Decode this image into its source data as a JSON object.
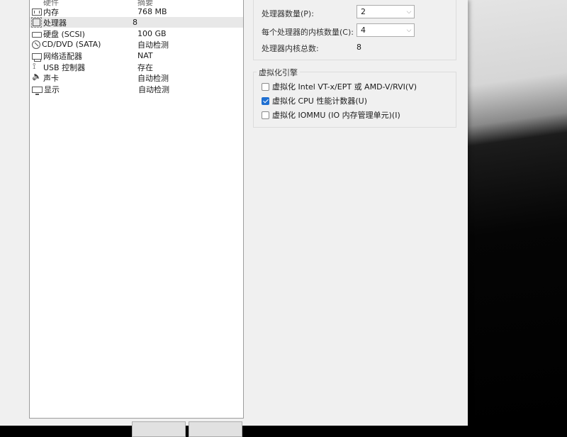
{
  "devices": [
    {
      "name": "硬件",
      "summary": "摘要",
      "icon": "none",
      "dim": true
    },
    {
      "name": "内存",
      "summary": "768 MB",
      "icon": "memory-icon"
    },
    {
      "name": "处理器",
      "summary": "8",
      "icon": "processor-icon",
      "selected": true
    },
    {
      "name": "硬盘 (SCSI)",
      "summary": "100 GB",
      "icon": "hard-disk-icon"
    },
    {
      "name": "CD/DVD (SATA)",
      "summary": "自动检测",
      "icon": "cd-dvd-icon"
    },
    {
      "name": "网络适配器",
      "summary": "NAT",
      "icon": "network-adapter-icon"
    },
    {
      "name": "USB 控制器",
      "summary": "存在",
      "icon": "usb-icon"
    },
    {
      "name": "声卡",
      "summary": "自动检测",
      "icon": "sound-card-icon"
    },
    {
      "name": "显示",
      "summary": "自动检测",
      "icon": "display-icon"
    }
  ],
  "processors": {
    "count_label": "处理器数量(P):",
    "count_value": "2",
    "cores_label": "每个处理器的内核数量(C):",
    "cores_value": "4",
    "total_label": "处理器内核总数:",
    "total_value": "8"
  },
  "virtualization": {
    "title": "虚拟化引擎",
    "options": [
      {
        "label": "虚拟化 Intel VT-x/EPT 或 AMD-V/RVI(V)",
        "checked": false
      },
      {
        "label": "虚拟化 CPU 性能计数器(U)",
        "checked": true
      },
      {
        "label": "虚拟化 IOMMU (IO 内存管理单元)(I)",
        "checked": false
      }
    ]
  },
  "colors": {
    "accent": "#1f6fd1",
    "window_bg": "#f0f0f0"
  }
}
